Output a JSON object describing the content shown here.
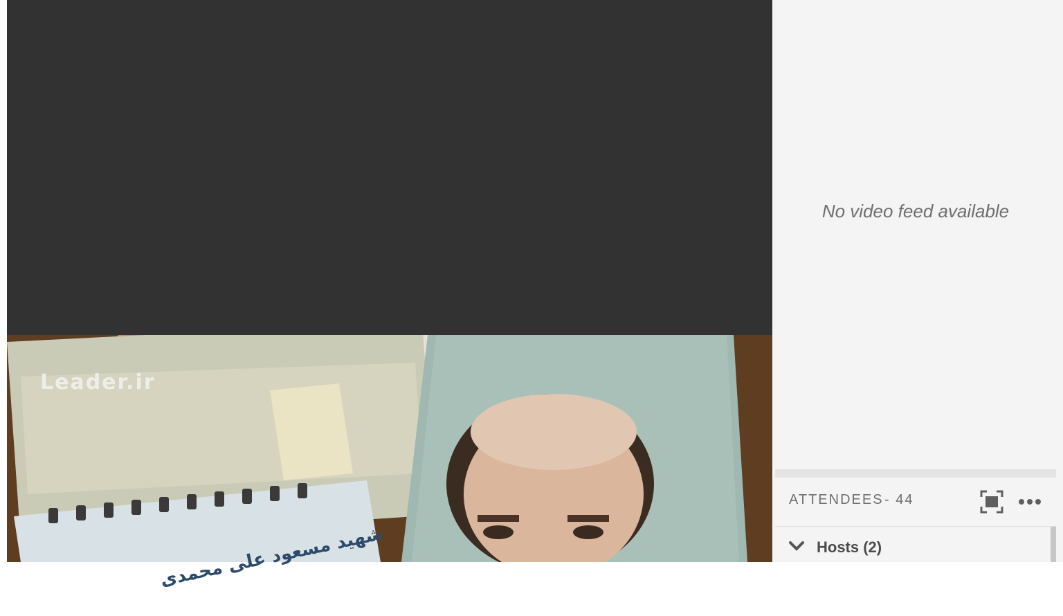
{
  "share_pod": {
    "background": "#323232"
  },
  "video": {
    "watermark": "Leader.ir",
    "note_text": "شهید مسعود علی محمدی"
  },
  "camera_pod": {
    "status_text": "No video feed available"
  },
  "attendees": {
    "title": "ATTENDEES",
    "count": "- 44",
    "maximize_icon": "maximize-icon",
    "more_icon": "more-options-icon",
    "groups": [
      {
        "label": "Hosts (2)",
        "expanded": true
      }
    ]
  }
}
